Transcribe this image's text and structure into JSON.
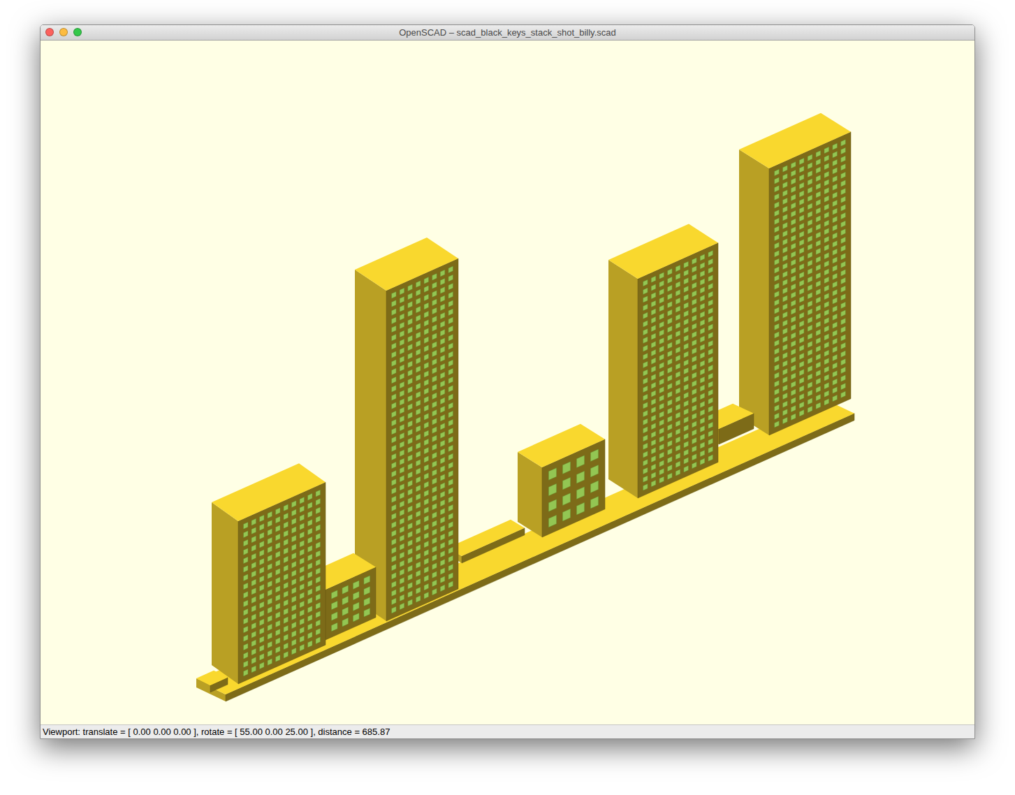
{
  "window": {
    "title": "OpenSCAD – scad_black_keys_stack_shot_billy.scad",
    "buttons": [
      {
        "color": "#fc615d"
      },
      {
        "color": "#fdbc40"
      },
      {
        "color": "#34c84a"
      }
    ]
  },
  "status_bar": {
    "text": "Viewport: translate = [ 0.00 0.00 0.00 ], rotate = [ 55.00 0.00 25.00 ], distance = 685.87"
  }
}
